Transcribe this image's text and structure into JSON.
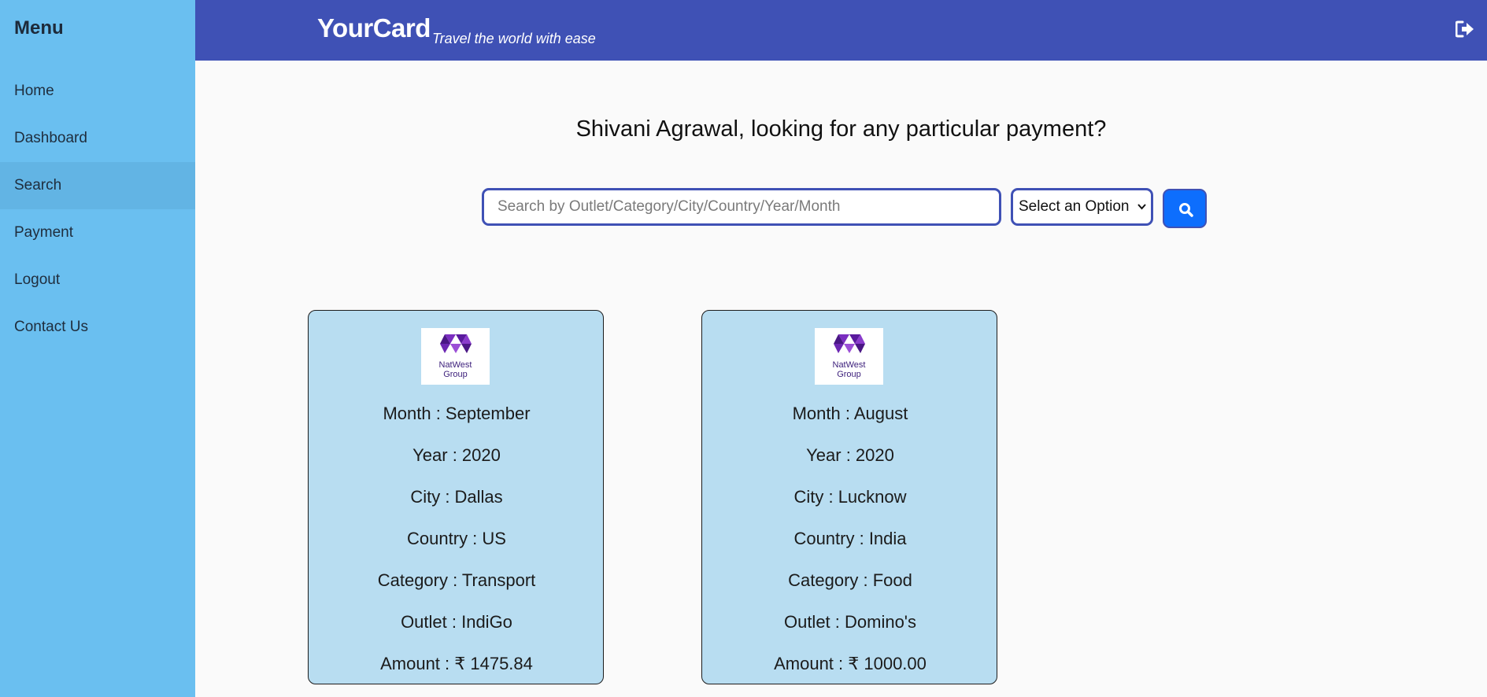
{
  "sidebar": {
    "title": "Menu",
    "items": [
      {
        "label": "Home"
      },
      {
        "label": "Dashboard"
      },
      {
        "label": "Search"
      },
      {
        "label": "Payment"
      },
      {
        "label": "Logout"
      },
      {
        "label": "Contact Us"
      }
    ]
  },
  "header": {
    "brand": "YourCard",
    "tagline": "Travel the world with ease",
    "logout_icon": "sign-out-icon"
  },
  "main": {
    "heading": "Shivani Agrawal, looking for any particular payment?",
    "search": {
      "placeholder": "Search by Outlet/Category/City/Country/Year/Month",
      "value": ""
    },
    "select": {
      "selected": "Select an Option"
    },
    "search_button_icon": "search-icon"
  },
  "logo": {
    "line1": "NatWest",
    "line2": "Group"
  },
  "cards": [
    {
      "month": "Month : September",
      "year": "Year : 2020",
      "city": "City : Dallas",
      "country": "Country : US",
      "category": "Category : Transport",
      "outlet": "Outlet : IndiGo",
      "amount": "Amount : ₹ 1475.84"
    },
    {
      "month": "Month : August",
      "year": "Year : 2020",
      "city": "City : Lucknow",
      "country": "Country : India",
      "category": "Category : Food",
      "outlet": "Outlet : Domino's",
      "amount": "Amount : ₹ 1000.00"
    }
  ],
  "colors": {
    "sidebar_bg": "#6abff0",
    "header_bg": "#3f51b5",
    "card_bg": "#b8ddf1",
    "button_bg": "#0d6efd",
    "logo_purple": "#5a1a9e"
  }
}
